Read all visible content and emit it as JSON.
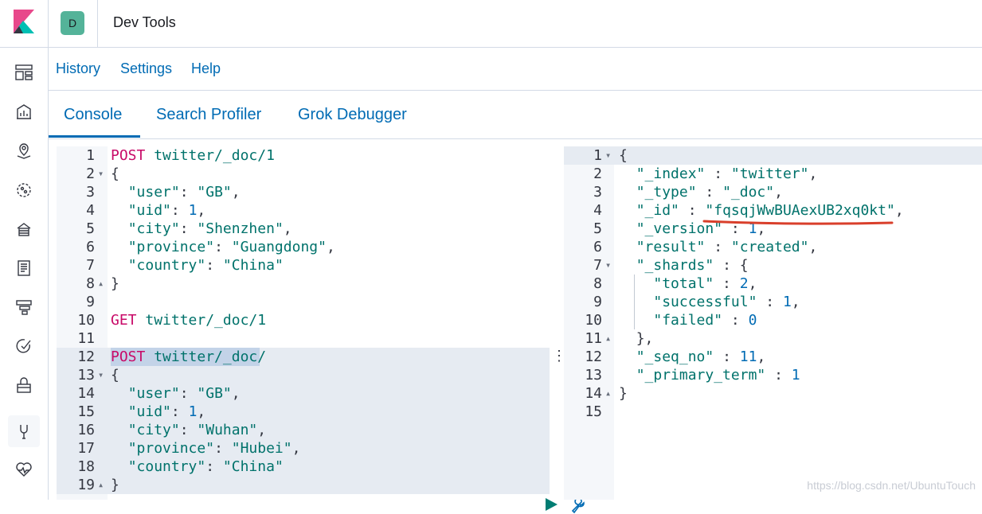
{
  "header": {
    "avatar_letter": "D",
    "avatar_color": "#54b399",
    "title": "Dev Tools"
  },
  "sidenav": {
    "items": [
      {
        "icon": "dashboard-icon"
      },
      {
        "icon": "visualize-icon"
      },
      {
        "icon": "maps-icon"
      },
      {
        "icon": "ml-icon"
      },
      {
        "icon": "infrastructure-icon"
      },
      {
        "icon": "logs-icon"
      },
      {
        "icon": "apm-icon"
      },
      {
        "icon": "uptime-icon"
      },
      {
        "icon": "siem-icon"
      },
      {
        "icon": "dev-tools-icon",
        "active": true
      },
      {
        "icon": "monitoring-icon"
      }
    ]
  },
  "top_menu": {
    "history": "History",
    "settings": "Settings",
    "help": "Help"
  },
  "tabs": [
    {
      "label": "Console",
      "active": true
    },
    {
      "label": "Search Profiler"
    },
    {
      "label": "Grok Debugger"
    }
  ],
  "request_editor": {
    "lines": [
      {
        "n": "1",
        "fold": "",
        "text": "POST twitter/_doc/1"
      },
      {
        "n": "2",
        "fold": "▾",
        "text": "{"
      },
      {
        "n": "3",
        "fold": "",
        "text": "  \"user\": \"GB\","
      },
      {
        "n": "4",
        "fold": "",
        "text": "  \"uid\": 1,"
      },
      {
        "n": "5",
        "fold": "",
        "text": "  \"city\": \"Shenzhen\","
      },
      {
        "n": "6",
        "fold": "",
        "text": "  \"province\": \"Guangdong\","
      },
      {
        "n": "7",
        "fold": "",
        "text": "  \"country\": \"China\""
      },
      {
        "n": "8",
        "fold": "▴",
        "text": "}"
      },
      {
        "n": "9",
        "fold": "",
        "text": ""
      },
      {
        "n": "10",
        "fold": "",
        "text": "GET twitter/_doc/1"
      },
      {
        "n": "11",
        "fold": "",
        "text": ""
      },
      {
        "n": "12",
        "fold": "",
        "text": "POST twitter/_doc/"
      },
      {
        "n": "13",
        "fold": "▾",
        "text": "{"
      },
      {
        "n": "14",
        "fold": "",
        "text": "  \"user\": \"GB\","
      },
      {
        "n": "15",
        "fold": "",
        "text": "  \"uid\": 1,"
      },
      {
        "n": "16",
        "fold": "",
        "text": "  \"city\": \"Wuhan\","
      },
      {
        "n": "17",
        "fold": "",
        "text": "  \"province\": \"Hubei\","
      },
      {
        "n": "18",
        "fold": "",
        "text": "  \"country\": \"China\""
      },
      {
        "n": "19",
        "fold": "▴",
        "text": "}"
      }
    ]
  },
  "response_editor": {
    "lines": [
      {
        "n": "1",
        "fold": "▾",
        "text": "{"
      },
      {
        "n": "2",
        "fold": "",
        "text": "  \"_index\" : \"twitter\","
      },
      {
        "n": "3",
        "fold": "",
        "text": "  \"_type\" : \"_doc\","
      },
      {
        "n": "4",
        "fold": "",
        "text": "  \"_id\" : \"fqsqjWwBUAexUB2xq0kt\","
      },
      {
        "n": "5",
        "fold": "",
        "text": "  \"_version\" : 1,"
      },
      {
        "n": "6",
        "fold": "",
        "text": "  \"result\" : \"created\","
      },
      {
        "n": "7",
        "fold": "▾",
        "text": "  \"_shards\" : {"
      },
      {
        "n": "8",
        "fold": "",
        "text": "    \"total\" : 2,"
      },
      {
        "n": "9",
        "fold": "",
        "text": "    \"successful\" : 1,"
      },
      {
        "n": "10",
        "fold": "",
        "text": "    \"failed\" : 0"
      },
      {
        "n": "11",
        "fold": "▴",
        "text": "  },"
      },
      {
        "n": "12",
        "fold": "",
        "text": "  \"_seq_no\" : 11,"
      },
      {
        "n": "13",
        "fold": "",
        "text": "  \"_primary_term\" : 1"
      },
      {
        "n": "14",
        "fold": "▴",
        "text": "}"
      },
      {
        "n": "15",
        "fold": "",
        "text": ""
      }
    ]
  },
  "watermark": "https://blog.csdn.net/UbuntuTouch"
}
